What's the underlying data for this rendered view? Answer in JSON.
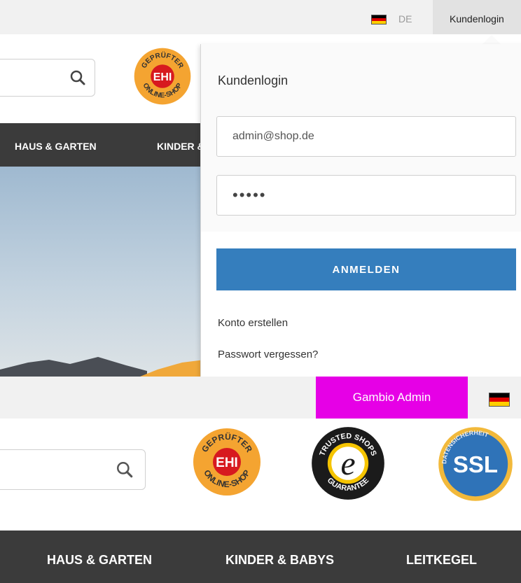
{
  "topbar": {
    "language_code": "DE",
    "login_tab_label": "Kundenlogin"
  },
  "top_nav": {
    "items": [
      "HAUS & GARTEN",
      "KINDER & BABYS"
    ]
  },
  "badges": {
    "ehi": {
      "top_text": "GEPRÜFTER",
      "center_text": "EHI",
      "bottom_text": "ONLINE-SHOP"
    },
    "trusted_shops": {
      "top_text": "TRUSTED SHOPS",
      "center_text": "e",
      "bottom_text": "GUARANTEE"
    },
    "ssl": {
      "ring_text": "DATENSICHERHEIT",
      "center_text": "SSL"
    }
  },
  "login_popup": {
    "title": "Kundenlogin",
    "email_value": "admin@shop.de",
    "password_value": "•••••",
    "submit_label": "ANMELDEN",
    "create_account_link": "Konto erstellen",
    "forgot_password_link": "Passwort vergessen?"
  },
  "admin_bar": {
    "button_label": "Gambio Admin"
  },
  "bottom_nav": {
    "items": [
      "HAUS & GARTEN",
      "KINDER & BABYS",
      "LEITKEGEL"
    ]
  },
  "colors": {
    "admin_magenta": "#e600e6",
    "submit_blue": "#357ebd",
    "nav_dark": "#3b3b3b",
    "ehi_orange": "#f4a431",
    "ehi_red": "#d7191f",
    "ssl_blue": "#2f73b8",
    "ssl_gold": "#f2b93b"
  }
}
